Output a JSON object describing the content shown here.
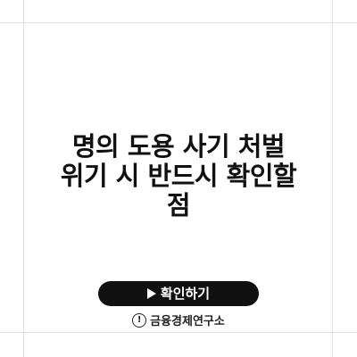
{
  "title": {
    "line1": "명의 도용 사기 처벌",
    "line2": "위기 시 반드시 확인할",
    "line3": "점"
  },
  "cta": {
    "label": "확인하기",
    "icon": "play-icon"
  },
  "source": {
    "icon": "warning-icon",
    "icon_glyph": "!",
    "label": "금융경제연구소"
  }
}
